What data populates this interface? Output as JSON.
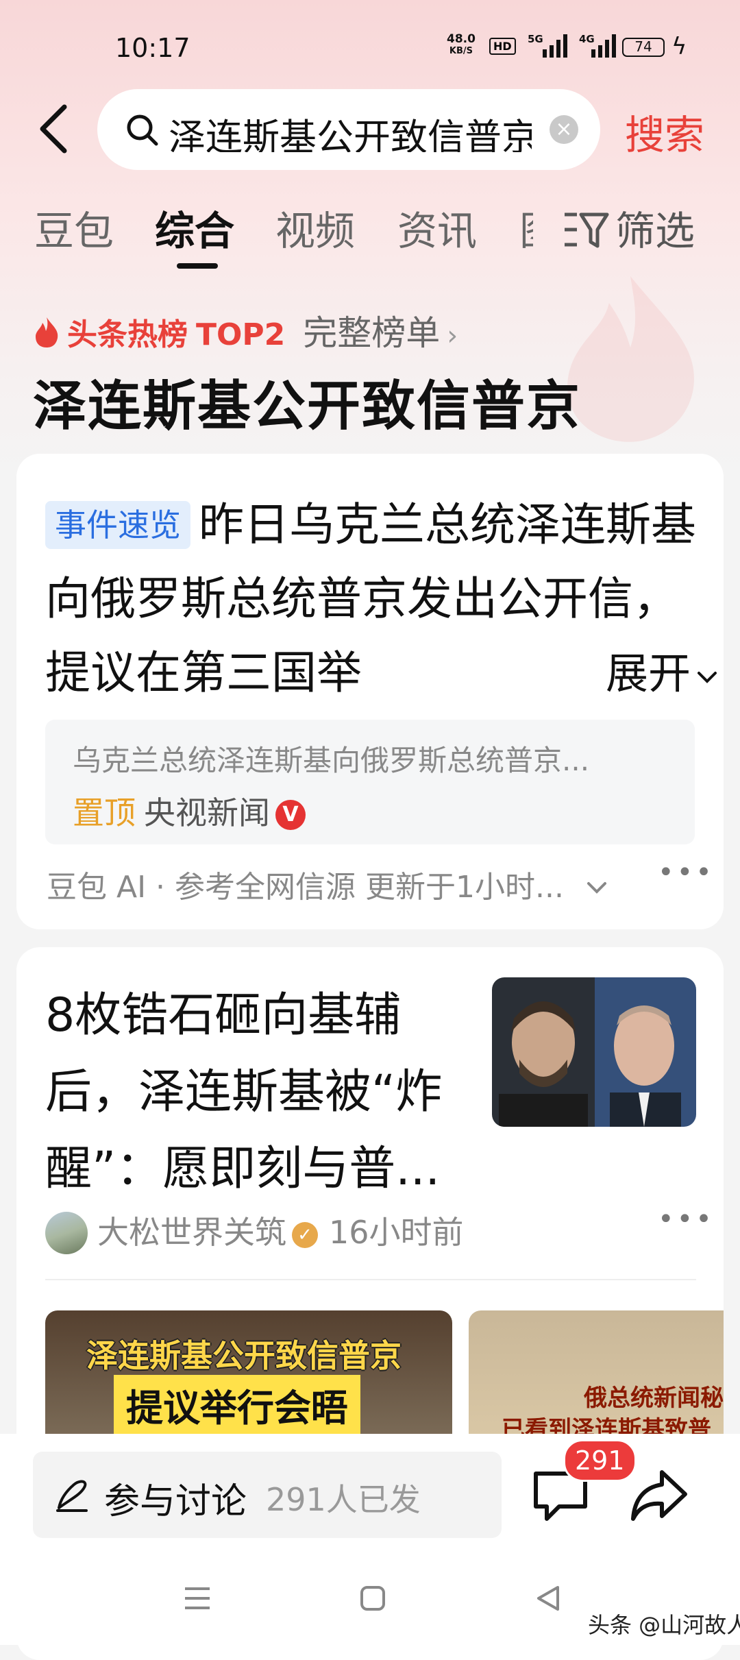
{
  "status_bar": {
    "time": "10:17",
    "net_rate_value": "48.0",
    "net_rate_unit": "KB/S",
    "hd_label": "HD",
    "signal1_label": "5G",
    "signal2_label": "4G",
    "battery": "74"
  },
  "search": {
    "query": "泽连斯基公开致信普京",
    "button_label": "搜索"
  },
  "tabs": [
    {
      "label": "豆包"
    },
    {
      "label": "综合"
    },
    {
      "label": "视频"
    },
    {
      "label": "资讯"
    },
    {
      "label": "图"
    }
  ],
  "active_tab": "综合",
  "filter_label": "筛选",
  "hot": {
    "label": "头条热榜",
    "rank": "TOP2",
    "full_list": "完整榜单",
    "title": "泽连斯基公开致信普京"
  },
  "card1": {
    "badge": "事件速览",
    "text": "昨日乌克兰总统泽连斯基向俄罗斯总统普京发出公开信，提议在第三国举",
    "expand": "展开",
    "quote": "乌克兰总统泽连斯基向俄罗斯总统普京...",
    "pin_label": "置顶",
    "source": "央视新闻",
    "verified_badge": "V",
    "footer": "豆包 AI · 参考全网信源 更新于1小时..."
  },
  "card2": {
    "title": "8枚锆石砸向基辅后，泽连斯基被“炸醒”：愿即刻与普...",
    "author": "大松世界关筑",
    "time": "16小时前",
    "video1_line1": "泽连斯基公开致信普京",
    "video1_line2": "提议举行会晤",
    "video2_line1": "俄总统新闻秘",
    "video2_line2": "已看到泽连斯基致普"
  },
  "bottom": {
    "discuss_label": "参与讨论",
    "discuss_count": "291人已发",
    "comment_count": "291"
  },
  "watermark": "头条 @山河故人",
  "colors": {
    "accent_red": "#e8413a",
    "badge_blue": "#2a6ee0",
    "pin_orange": "#e8a028"
  }
}
